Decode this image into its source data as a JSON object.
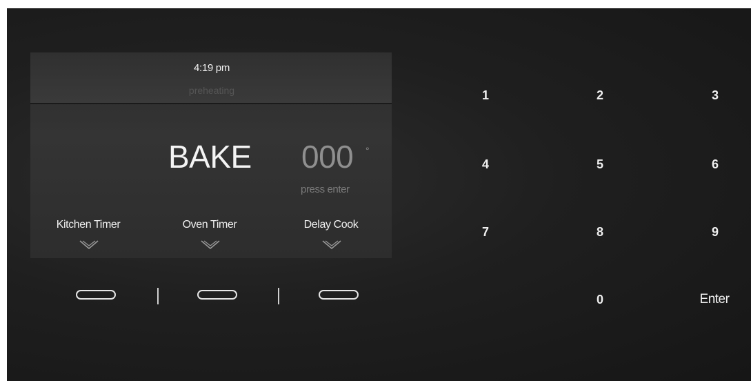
{
  "display": {
    "time": "4:19 pm",
    "status": "preheating",
    "mode": "BAKE",
    "temperature": "000",
    "degree_symbol": "°",
    "hint": "press enter"
  },
  "functions": [
    {
      "label": "Kitchen Timer",
      "icon": "chevron-down-icon"
    },
    {
      "label": "Oven Timer",
      "icon": "chevron-down-icon"
    },
    {
      "label": "Delay Cook",
      "icon": "chevron-down-icon"
    }
  ],
  "keypad": {
    "keys": [
      "1",
      "2",
      "3",
      "4",
      "5",
      "6",
      "7",
      "8",
      "9",
      "0",
      "Enter"
    ]
  },
  "colors": {
    "background": "#1c1c1c",
    "display_panel": "#333333",
    "text": "#f0f0f0",
    "dim_text": "#8f8f8f"
  }
}
